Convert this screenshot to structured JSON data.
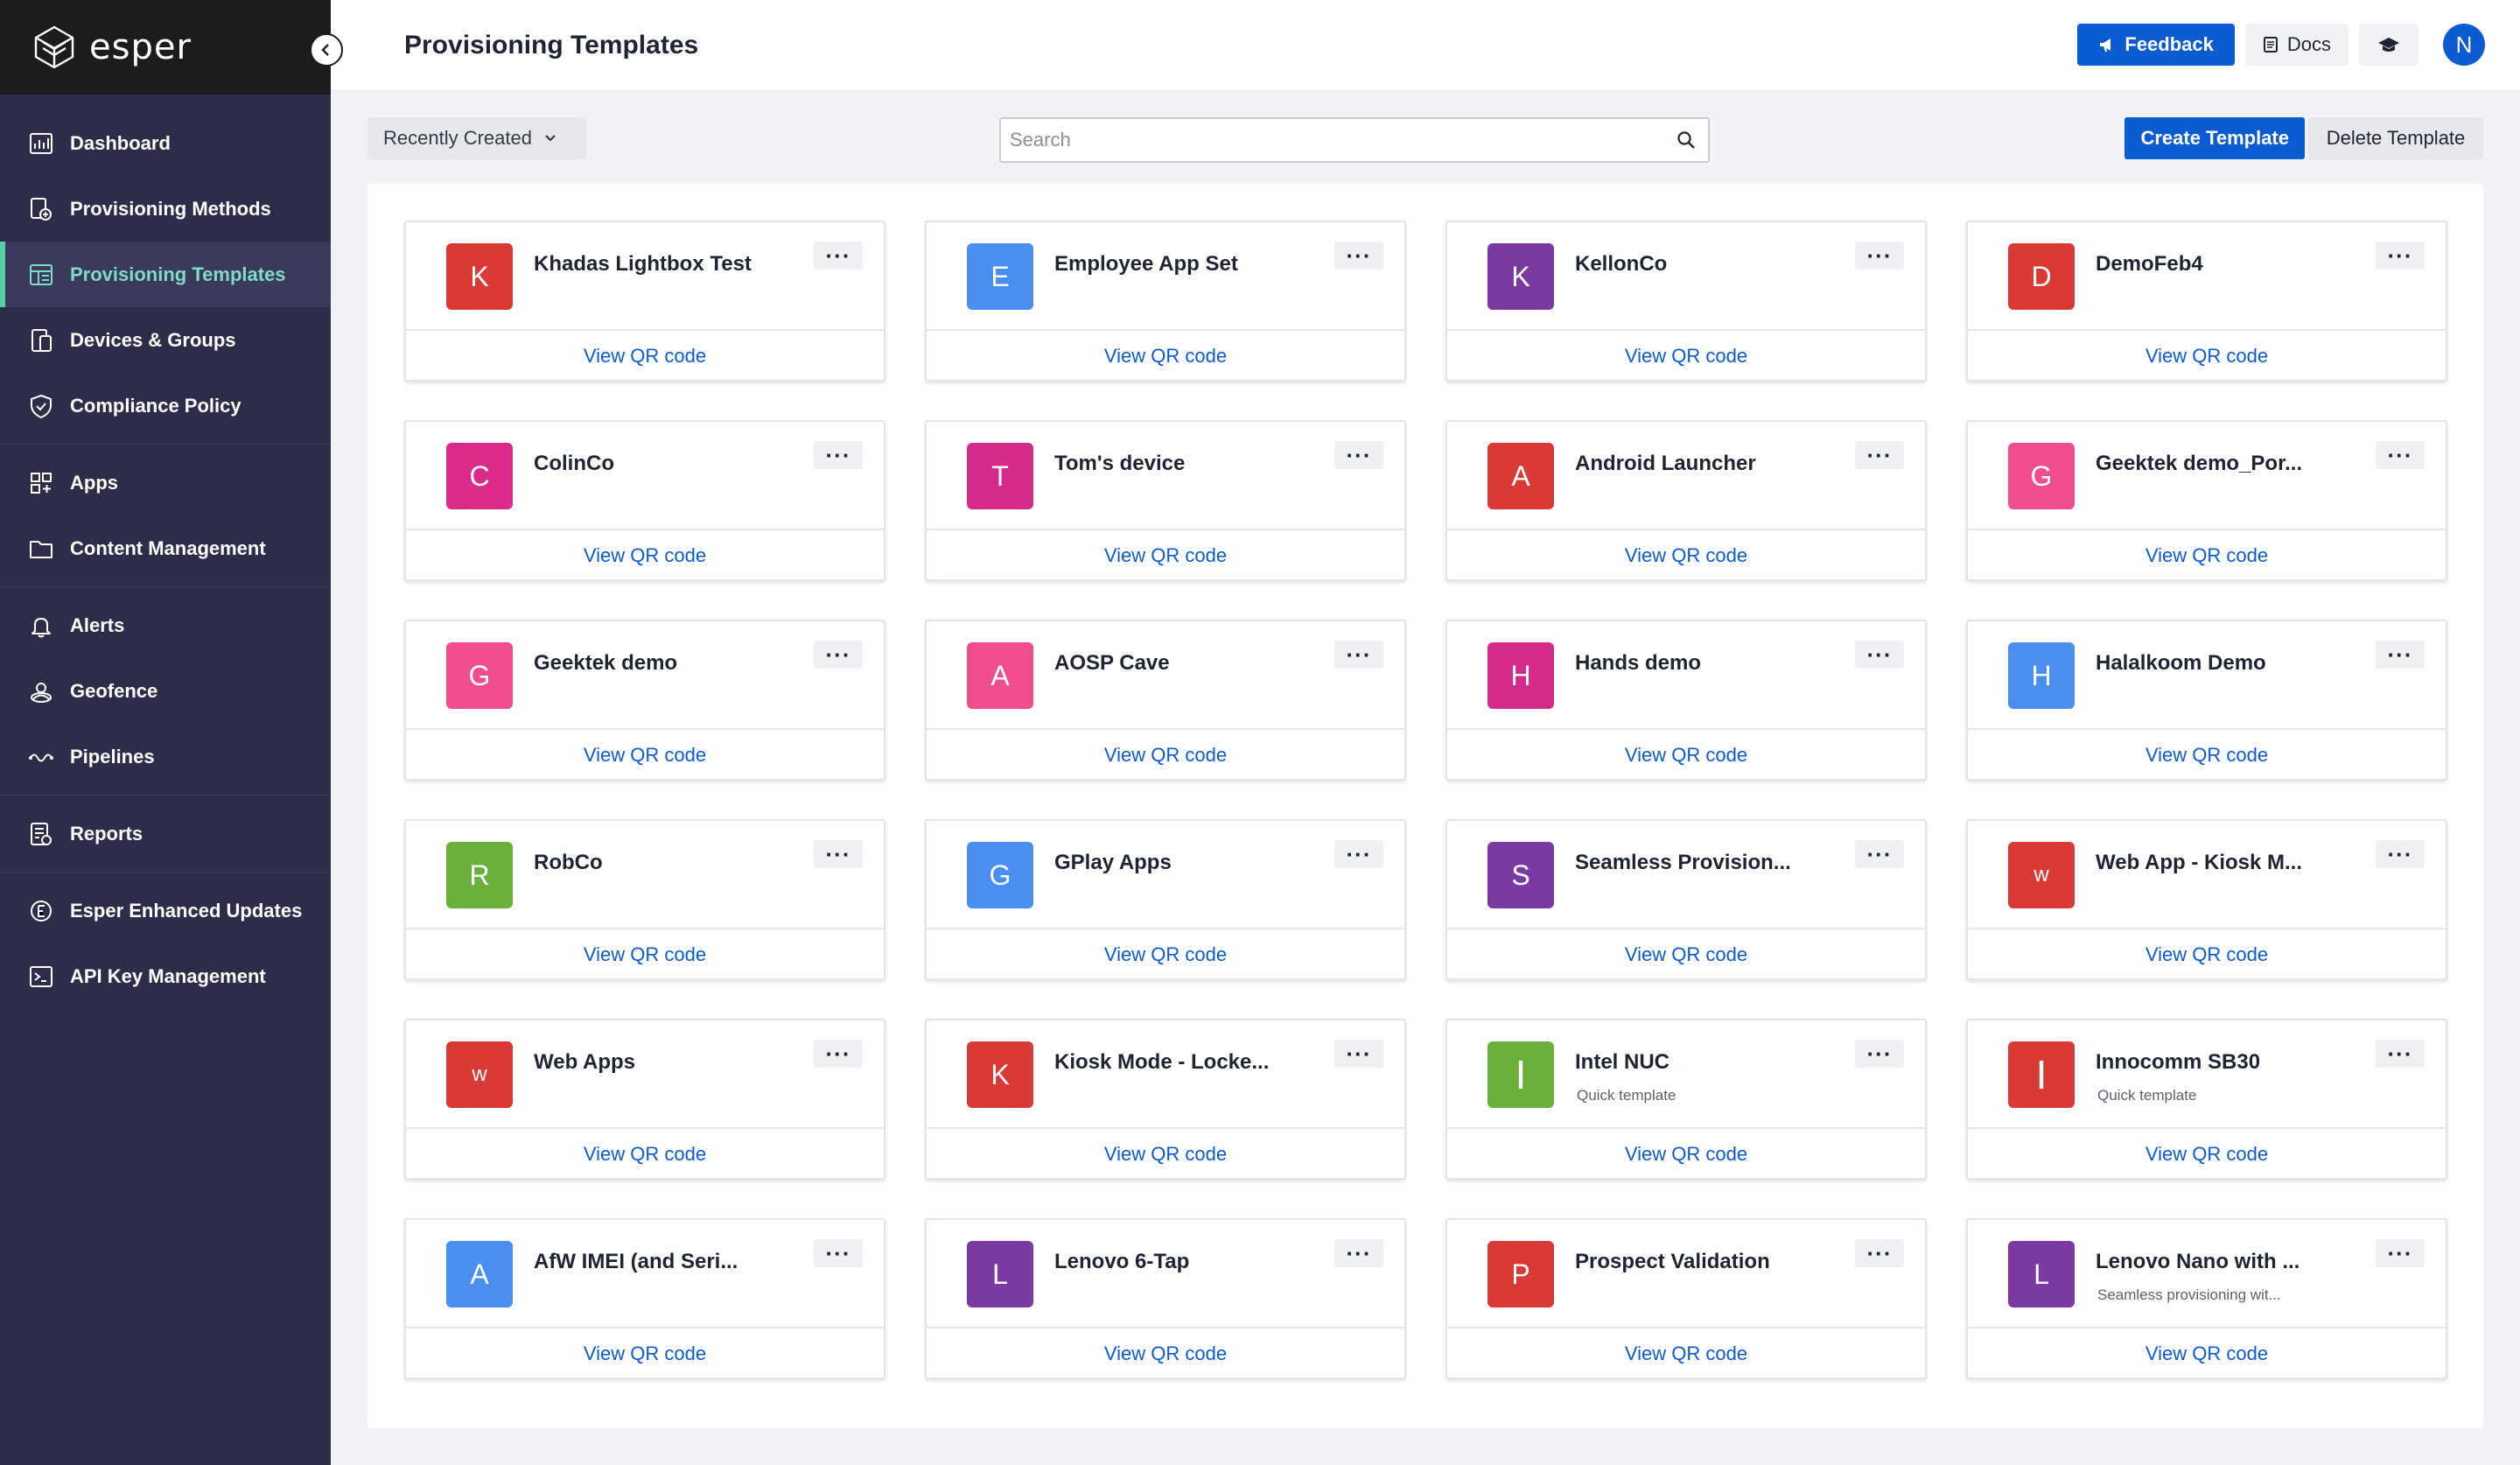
{
  "brand": {
    "name": "esper"
  },
  "sidebar": {
    "groups": [
      [
        {
          "id": "dashboard",
          "label": "Dashboard",
          "icon": "dashboard-icon"
        },
        {
          "id": "provisioning-methods",
          "label": "Provisioning Methods",
          "icon": "provisioning-methods-icon"
        },
        {
          "id": "provisioning-templates",
          "label": "Provisioning Templates",
          "icon": "provisioning-templates-icon",
          "active": true
        },
        {
          "id": "devices-groups",
          "label": "Devices & Groups",
          "icon": "devices-icon"
        },
        {
          "id": "compliance-policy",
          "label": "Compliance Policy",
          "icon": "shield-icon"
        }
      ],
      [
        {
          "id": "apps",
          "label": "Apps",
          "icon": "apps-icon"
        },
        {
          "id": "content-management",
          "label": "Content Management",
          "icon": "folder-icon"
        }
      ],
      [
        {
          "id": "alerts",
          "label": "Alerts",
          "icon": "bell-icon"
        },
        {
          "id": "geofence",
          "label": "Geofence",
          "icon": "geofence-icon"
        },
        {
          "id": "pipelines",
          "label": "Pipelines",
          "icon": "pipelines-icon"
        }
      ],
      [
        {
          "id": "reports",
          "label": "Reports",
          "icon": "reports-icon"
        }
      ],
      [
        {
          "id": "esper-enhanced-updates",
          "label": "Esper Enhanced Updates",
          "icon": "updates-icon"
        },
        {
          "id": "api-key-management",
          "label": "API Key Management",
          "icon": "terminal-icon"
        }
      ]
    ]
  },
  "header": {
    "title": "Provisioning Templates",
    "feedback_label": "Feedback",
    "docs_label": "Docs",
    "user_initial": "N"
  },
  "toolbar": {
    "sort_label": "Recently Created",
    "search_placeholder": "Search",
    "create_label": "Create Template",
    "delete_label": "Delete Template"
  },
  "colors": {
    "primary": "#0b5bd3",
    "sidebar_bg": "#2d2d4a",
    "accent_active": "#57cfa9"
  },
  "templates": [
    {
      "initial": "K",
      "name": "Khadas Lightbox Test",
      "color": "#d93a35"
    },
    {
      "initial": "E",
      "name": "Employee App Set",
      "color": "#4a8ef0"
    },
    {
      "initial": "K",
      "name": "KellonCo",
      "color": "#7b3aa1"
    },
    {
      "initial": "D",
      "name": "DemoFeb4",
      "color": "#d93a35"
    },
    {
      "initial": "C",
      "name": "ColinCo",
      "color": "#db2b8a"
    },
    {
      "initial": "T",
      "name": "Tom's device",
      "color": "#d42a8a"
    },
    {
      "initial": "A",
      "name": "Android Launcher",
      "color": "#d93a35"
    },
    {
      "initial": "G",
      "name": "Geektek demo_Por...",
      "color": "#ef4d8e"
    },
    {
      "initial": "G",
      "name": "Geektek demo",
      "color": "#ef4d8e"
    },
    {
      "initial": "A",
      "name": "AOSP Cave",
      "color": "#ef4d8e"
    },
    {
      "initial": "H",
      "name": "Hands demo",
      "color": "#d42a8a"
    },
    {
      "initial": "H",
      "name": "Halalkoom Demo",
      "color": "#4a8ef0"
    },
    {
      "initial": "R",
      "name": "RobCo",
      "color": "#6ab03c"
    },
    {
      "initial": "G",
      "name": "GPlay Apps",
      "color": "#4a8ef0"
    },
    {
      "initial": "S",
      "name": "Seamless Provision...",
      "color": "#7b3aa1"
    },
    {
      "initial": "w",
      "name": "Web App - Kiosk M...",
      "color": "#d93a35",
      "small": true
    },
    {
      "initial": "w",
      "name": "Web Apps",
      "color": "#d93a35",
      "small": true
    },
    {
      "initial": "K",
      "name": "Kiosk Mode - Locke...",
      "color": "#d93a35"
    },
    {
      "initial": "I",
      "name": "Intel NUC",
      "color": "#6ab03c",
      "sub": "Quick template",
      "big": true
    },
    {
      "initial": "I",
      "name": "Innocomm SB30",
      "color": "#d93a35",
      "sub": "Quick template",
      "big": true
    },
    {
      "initial": "A",
      "name": "AfW IMEI (and Seri...",
      "color": "#4a8ef0"
    },
    {
      "initial": "L",
      "name": "Lenovo 6-Tap",
      "color": "#7b3aa1"
    },
    {
      "initial": "P",
      "name": "Prospect Validation",
      "color": "#d93a35"
    },
    {
      "initial": "L",
      "name": "Lenovo Nano with ...",
      "color": "#7b3aa1",
      "sub": "Seamless provisioning wit..."
    }
  ],
  "card_menu_label": "···",
  "card_link_label": "View QR code"
}
